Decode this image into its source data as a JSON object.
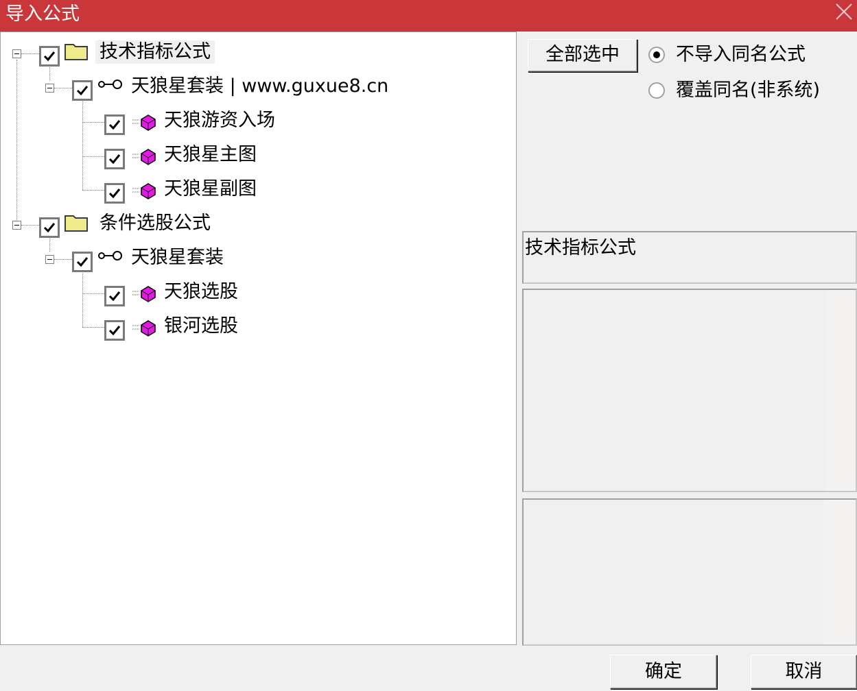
{
  "window": {
    "title": "导入公式",
    "close_icon": "close-icon"
  },
  "tree": {
    "groups": [
      {
        "label": "技术指标公式",
        "icon": "folder-icon",
        "checked": true,
        "sets": [
          {
            "label": "天狼星套装 | www.guxue8.cn",
            "icon": "key-icon",
            "checked": true,
            "items": [
              {
                "label": "天狼游资入场",
                "icon": "formula-cube-icon",
                "checked": true
              },
              {
                "label": "天狼星主图",
                "icon": "formula-cube-icon",
                "checked": true
              },
              {
                "label": "天狼星副图",
                "icon": "formula-cube-icon",
                "checked": true
              }
            ]
          }
        ]
      },
      {
        "label": "条件选股公式",
        "icon": "folder-icon",
        "checked": true,
        "sets": [
          {
            "label": "天狼星套装",
            "icon": "key-icon",
            "checked": true,
            "items": [
              {
                "label": "天狼选股",
                "icon": "formula-cube-icon",
                "checked": true
              },
              {
                "label": "银河选股",
                "icon": "formula-cube-icon",
                "checked": true
              }
            ]
          }
        ]
      }
    ]
  },
  "options": {
    "select_all_label": "全部选中",
    "radio_options": [
      {
        "label": "不导入同名公式",
        "checked": true
      },
      {
        "label": "覆盖同名(非系统)",
        "checked": false
      }
    ]
  },
  "info": {
    "category_text": "技术指标公式",
    "description_text": "",
    "detail_text": ""
  },
  "footer": {
    "ok_label": "确定",
    "cancel_label": "取消"
  }
}
